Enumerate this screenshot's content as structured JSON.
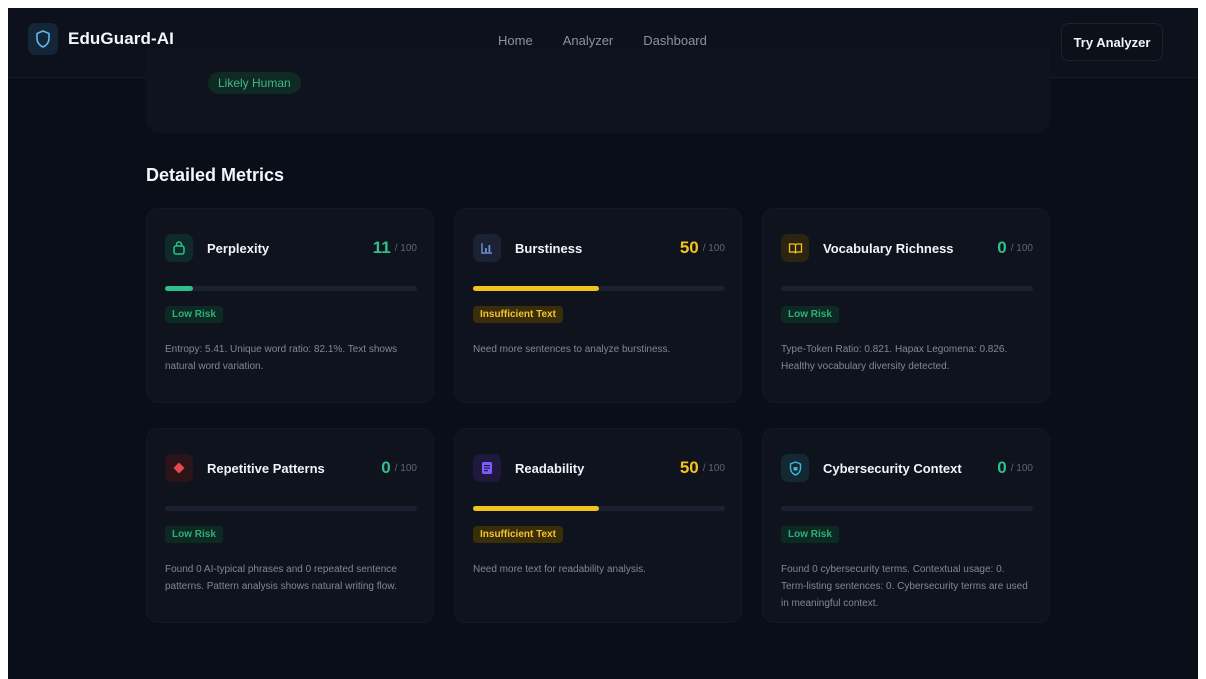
{
  "nav": {
    "brand": "EduGuard-AI",
    "links": [
      "Home",
      "Analyzer",
      "Dashboard"
    ],
    "cta": "Try Analyzer"
  },
  "top_card": {
    "badge": "Likely Human"
  },
  "section_title": "Detailed Metrics",
  "score_max": "/ 100",
  "colors": {
    "green": "#2fbf88",
    "yellow": "#f4c21c",
    "red": "#e5484d",
    "purple": "#7c5cff",
    "cyan": "#3fb8d6",
    "amber": "#f4c21c"
  },
  "cards": [
    {
      "name": "Perplexity",
      "score": "11",
      "progress": 0.11,
      "color": "#2fbf88",
      "icon": "shield-icon",
      "badge": "Low Risk",
      "badge_type": "low",
      "desc": "Entropy: 5.41. Unique word ratio: 82.1%. Text shows natural word variation."
    },
    {
      "name": "Burstiness",
      "score": "50",
      "progress": 0.5,
      "color": "#f4c21c",
      "icon": "bar-chart-icon",
      "badge": "Insufficient Text",
      "badge_type": "warn",
      "desc": "Need more sentences to analyze burstiness."
    },
    {
      "name": "Vocabulary Richness",
      "score": "0",
      "progress": 0,
      "color": "#2fbf88",
      "icon": "book-icon",
      "badge": "Low Risk",
      "badge_type": "low",
      "desc": "Type-Token Ratio: 0.821. Hapax Legomena: 0.826. Healthy vocabulary diversity detected."
    },
    {
      "name": "Repetitive Patterns",
      "score": "0",
      "progress": 0,
      "color": "#2fbf88",
      "icon": "diamond-icon",
      "badge": "Low Risk",
      "badge_type": "low",
      "desc": "Found 0 AI-typical phrases and 0 repeated sentence patterns. Pattern analysis shows natural writing flow."
    },
    {
      "name": "Readability",
      "score": "50",
      "progress": 0.5,
      "color": "#f4c21c",
      "icon": "document-icon",
      "badge": "Insufficient Text",
      "badge_type": "warn",
      "desc": "Need more text for readability analysis."
    },
    {
      "name": "Cybersecurity Context",
      "score": "0",
      "progress": 0,
      "color": "#2fbf88",
      "icon": "shield-check-icon",
      "badge": "Low Risk",
      "badge_type": "low",
      "desc": "Found 0 cybersecurity terms. Contextual usage: 0. Term-listing sentences: 0. Cybersecurity terms are used in meaningful context."
    }
  ]
}
